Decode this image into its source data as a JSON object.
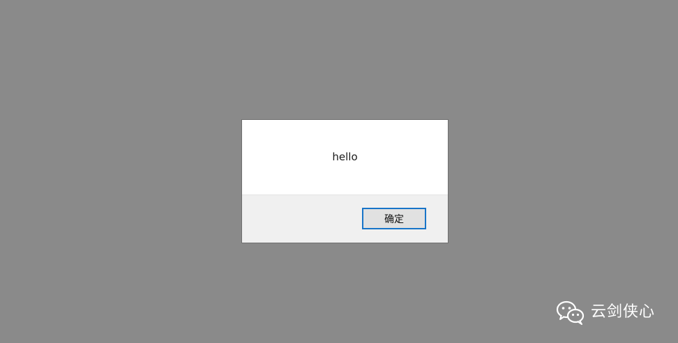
{
  "overlay": {
    "background_color": "#8a8a8a"
  },
  "dialog": {
    "message": "hello",
    "ok_button_label": "确定",
    "accent_color": "#1874c8"
  },
  "watermark": {
    "icon": "wechat-icon",
    "text": "云剑侠心"
  }
}
